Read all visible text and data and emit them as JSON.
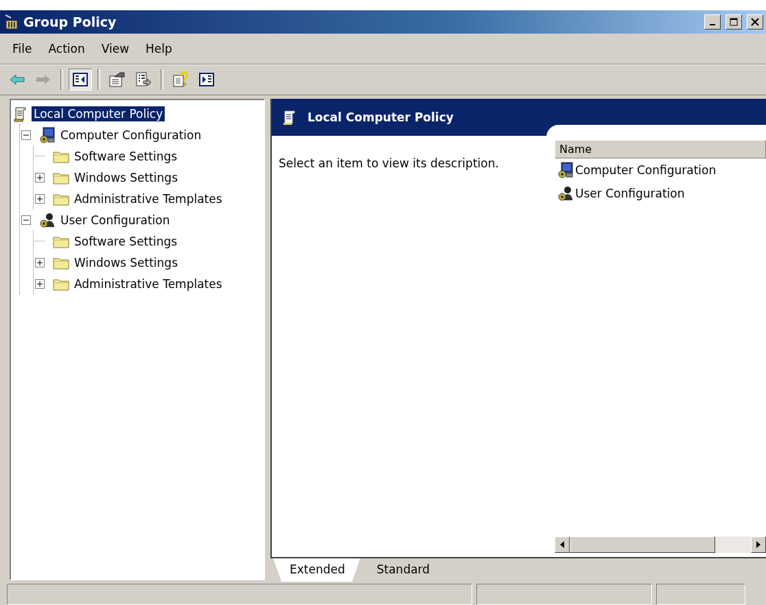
{
  "window": {
    "title": "Group Policy"
  },
  "menu": [
    {
      "label": "File"
    },
    {
      "label": "Action"
    },
    {
      "label": "View"
    },
    {
      "label": "Help"
    }
  ],
  "toolbar": [
    {
      "kind": "back",
      "disabled": false,
      "pressed": false
    },
    {
      "kind": "forward",
      "disabled": true,
      "pressed": false
    },
    {
      "kind": "separator"
    },
    {
      "kind": "tree-pane",
      "disabled": false,
      "pressed": true
    },
    {
      "kind": "separator"
    },
    {
      "kind": "properties",
      "disabled": false,
      "pressed": false
    },
    {
      "kind": "export",
      "disabled": false,
      "pressed": false
    },
    {
      "kind": "separator"
    },
    {
      "kind": "help",
      "disabled": false,
      "pressed": false
    },
    {
      "kind": "action-pane",
      "disabled": false,
      "pressed": false
    }
  ],
  "tree": {
    "items": [
      {
        "label": "Local Computer Policy",
        "kind": "policy",
        "selected": true,
        "children": [
          {
            "label": "Computer Configuration",
            "kind": "computer",
            "selected": false,
            "expandable": true,
            "expanded": true,
            "children": [
              {
                "label": "Software Settings",
                "kind": "folder",
                "selected": false,
                "expandable": false
              },
              {
                "label": "Windows Settings",
                "kind": "folder",
                "selected": false,
                "expandable": true,
                "expanded": false
              },
              {
                "label": "Administrative Templates",
                "kind": "folder",
                "selected": false,
                "expandable": true,
                "expanded": false
              }
            ]
          },
          {
            "label": "User Configuration",
            "kind": "user",
            "selected": false,
            "expandable": true,
            "expanded": true,
            "children": [
              {
                "label": "Software Settings",
                "kind": "folder",
                "selected": false,
                "expandable": false
              },
              {
                "label": "Windows Settings",
                "kind": "folder",
                "selected": false,
                "expandable": true,
                "expanded": false
              },
              {
                "label": "Administrative Templates",
                "kind": "folder",
                "selected": false,
                "expandable": true,
                "expanded": false
              }
            ]
          }
        ]
      }
    ]
  },
  "details": {
    "header": "Local Computer Policy",
    "description": "Select an item to view its description.",
    "list": {
      "columns": [
        "Name"
      ],
      "rows": [
        {
          "kind": "computer",
          "name": "Computer Configuration"
        },
        {
          "kind": "user",
          "name": "User Configuration"
        }
      ]
    },
    "tabs": [
      {
        "label": "Extended",
        "selected": true
      },
      {
        "label": "Standard",
        "selected": false
      }
    ]
  }
}
